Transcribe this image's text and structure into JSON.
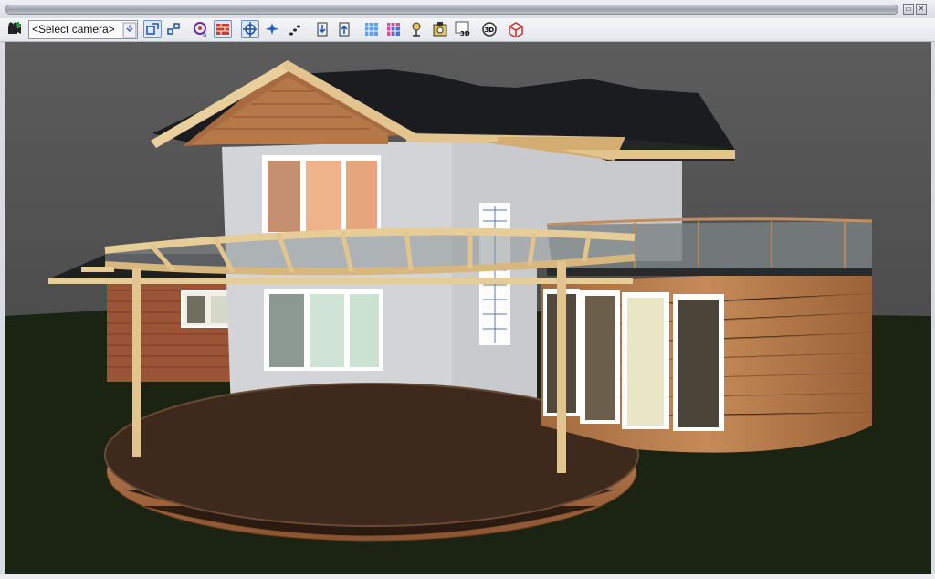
{
  "window": {
    "restore_glyph": "▭",
    "close_glyph": "✕"
  },
  "toolbar": {
    "camera_select_value": "<Select camera>",
    "buttons": [
      "add-camera-icon",
      "camera-select-icon",
      "zoom-window-icon",
      "zoom-extents-icon",
      "render-icon",
      "wall-texture-icon",
      "orbit-icon",
      "fly-icon",
      "walk-path-icon",
      "section-vertical-icon",
      "section-horizontal-icon",
      "blueprint-grid-icon",
      "color-grid-icon",
      "camera-view-icon",
      "photo-icon",
      "view-3d-icon",
      "rotate-3d-icon",
      "wireframe-icon"
    ],
    "labels": {
      "view_3d": "3D",
      "rotate_3d": "3D"
    }
  },
  "colors": {
    "viewport_sky": "#5b5b5b",
    "ground": "#1c2414",
    "wall": "#d8d9dc",
    "roof": "#1b1d20",
    "wood": "#e2c48e",
    "brick": "#a05a38",
    "deck": "#4a3020",
    "cladding": "#b77b4e"
  }
}
